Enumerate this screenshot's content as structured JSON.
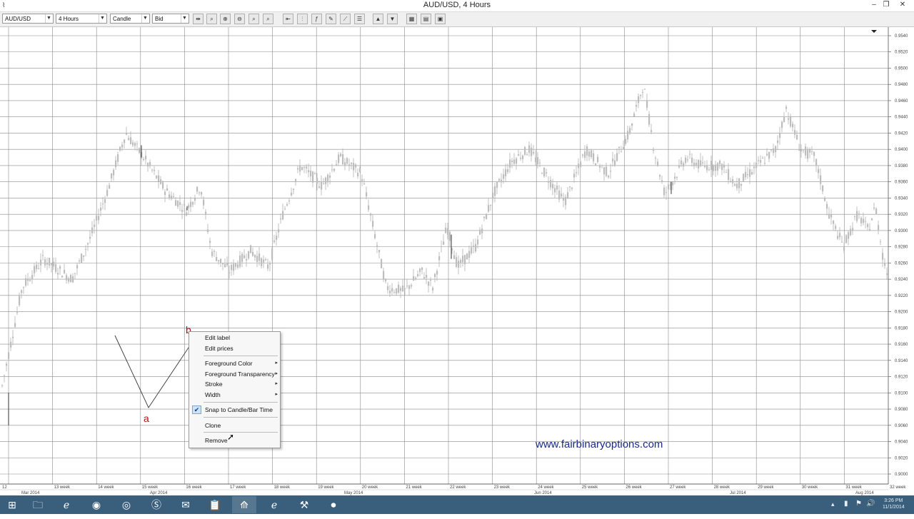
{
  "window": {
    "title": "AUD/USD,  4 Hours",
    "app_icon": "chart-app-icon"
  },
  "toolbar": {
    "symbol": "AUD/USD",
    "timeframe": "4 Hours",
    "chart_type": "Candle",
    "price_side": "Bid",
    "tool_icons": [
      "zoom-icon",
      "cursor-icon",
      "zoom-in-icon",
      "zoom-out-icon",
      "zoom-fit-icon",
      "zoom-area-icon",
      "scroll-left-icon",
      "period-separator-icon",
      "fx-indicator-icon",
      "drawing-tool-icon",
      "line-studies-icon",
      "buy-icon",
      "sell-icon",
      "grid-icon",
      "template-icon",
      "properties-icon"
    ]
  },
  "chart": {
    "price_ticks": [
      "0.9540",
      "0.9520",
      "0.9500",
      "0.9480",
      "0.9460",
      "0.9440",
      "0.9420",
      "0.9400",
      "0.9380",
      "0.9360",
      "0.9340",
      "0.9320",
      "0.9300",
      "0.9280",
      "0.9260",
      "0.9240",
      "0.9220",
      "0.9200",
      "0.9180",
      "0.9160",
      "0.9140",
      "0.9120",
      "0.9100",
      "0.9080",
      "0.9060",
      "0.9040",
      "0.9020",
      "0.9000"
    ],
    "week_ticks": [
      "12",
      "13 week",
      "14 week",
      "15 week",
      "16 week",
      "17 week",
      "18 week",
      "19 week",
      "20 week",
      "21 week",
      "22 week",
      "23 week",
      "24 week",
      "25 week",
      "26 week",
      "27 week",
      "28 week",
      "29 week",
      "30 week",
      "31 week",
      "32 week"
    ],
    "month_ticks": [
      "Mar 2014",
      "Apr 2014",
      "May 2014",
      "Jun 2014",
      "Jul 2014",
      "Aug 2014"
    ],
    "point_labels": {
      "a": "a",
      "b": "b"
    },
    "watermark": "www.fairbinaryoptions.com"
  },
  "context_menu": {
    "items": [
      {
        "label": "Edit label",
        "submenu": false,
        "checked": false
      },
      {
        "label": "Edit prices",
        "submenu": false,
        "checked": false
      },
      {
        "label": "Foreground Color",
        "submenu": true,
        "checked": false
      },
      {
        "label": "Foreground Transparency",
        "submenu": true,
        "checked": false
      },
      {
        "label": "Stroke",
        "submenu": true,
        "checked": false
      },
      {
        "label": "Width",
        "submenu": true,
        "checked": false
      },
      {
        "label": "Snap to Candle/Bar Time",
        "submenu": false,
        "checked": true
      },
      {
        "label": "Clone",
        "submenu": false,
        "checked": false
      },
      {
        "label": "Remove",
        "submenu": false,
        "checked": false
      }
    ],
    "submenu_glyph": "▸",
    "check_glyph": "✔"
  },
  "taskbar": {
    "apps": [
      "start-icon",
      "file-explorer-icon",
      "internet-explorer-icon",
      "chrome-icon",
      "firefox-icon",
      "skype-icon",
      "mail-icon",
      "clipboard-icon",
      "trading-app-icon",
      "ie-icon",
      "tool-icon",
      "media-player-icon"
    ],
    "clock_time": "3:26 PM",
    "clock_date": "11/1/2014"
  },
  "colors": {
    "candle": "#b8b8b8",
    "grid": "#555555",
    "label_red": "#b01010",
    "watermark": "#1a2a8a",
    "taskbar": "#3a5f7d"
  }
}
